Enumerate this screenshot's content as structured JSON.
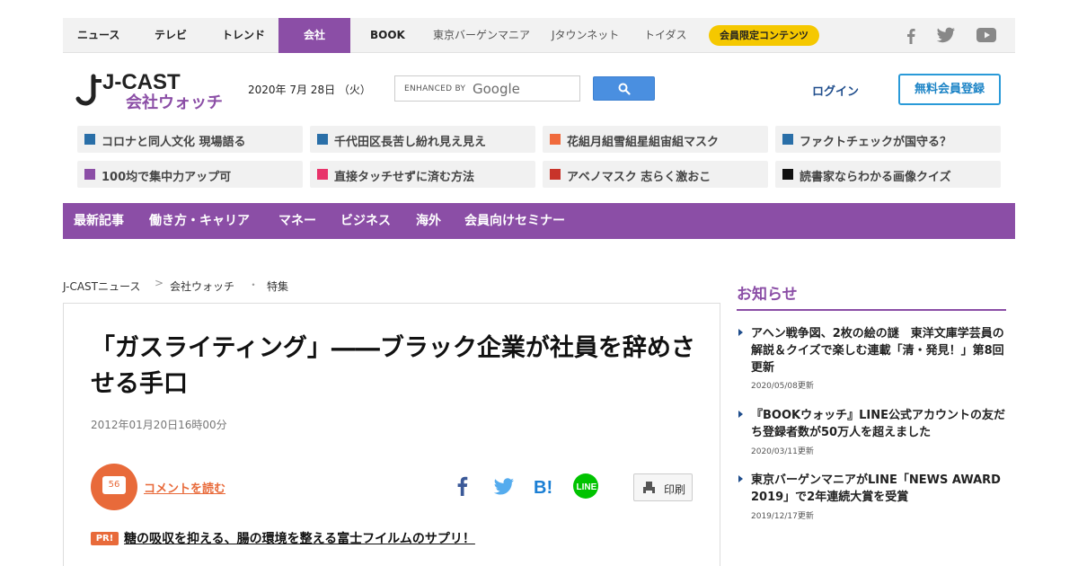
{
  "topnav": {
    "items": [
      "ニュース",
      "テレビ",
      "トレンド",
      "会社",
      "BOOK",
      "東京バーゲンマニア",
      "Jタウンネット",
      "トイダス"
    ],
    "member_label": "会員限定コンテンツ"
  },
  "header": {
    "logo_top": "J-CAST",
    "logo_bottom": "会社ウォッチ",
    "date": "2020年 7月 28日 （火）",
    "search_enhanced": "ENHANCED BY",
    "search_google": "Google",
    "login": "ログイン",
    "register": "無料会員登録"
  },
  "topics": [
    {
      "text": "コロナと同人文化 現場語る",
      "color": "#2a6fa8"
    },
    {
      "text": "千代田区長苦し紛れ見え見え",
      "color": "#2a6fa8"
    },
    {
      "text": "花組月組雪組星組宙組マスク",
      "color": "#f06a3c"
    },
    {
      "text": "ファクトチェックが国守る？",
      "color": "#2a6fa8"
    },
    {
      "text": "100均で集中力アップ可",
      "color": "#8b4ea6"
    },
    {
      "text": "直接タッチせずに済む方法",
      "color": "#e8336a"
    },
    {
      "text": "アベノマスク 志らく激おこ",
      "color": "#c8342a"
    },
    {
      "text": "読書家ならわかる画像クイズ",
      "color": "#111111"
    }
  ],
  "mainnav": [
    "最新記事",
    "働き方・キャリア",
    "マネー",
    "ビジネス",
    "海外",
    "会員向けセミナー"
  ],
  "breadcrumb": [
    "J-CASTニュース",
    "会社ウォッチ",
    "特集"
  ],
  "breadcrumb_separators": [
    ">",
    "・"
  ],
  "article": {
    "title": "「ガスライティング」――ブラック企業が社員を辞めさせる手口",
    "published": "2012年01月20日16時00分",
    "comment_count": "56",
    "comment_link": "コメントを読む",
    "print": "印刷",
    "pr_badge": "PR!",
    "pr_text": "糖の吸収を抑える、腸の環境を整える富士フイルムのサプリ！"
  },
  "sidebar": {
    "title": "お知らせ",
    "items": [
      {
        "text": "アヘン戦争図、2枚の絵の謎　東洋文庫学芸員の解説＆クイズで楽しむ連載「清・発見！」第8回更新",
        "date": "2020/05/08更新"
      },
      {
        "text": "『BOOKウォッチ』LINE公式アカウントの友だち登録者数が50万人を超えました",
        "date": "2020/03/11更新"
      },
      {
        "text": "東京バーゲンマニアがLINE「NEWS AWARD 2019」で2年連続大賞を受賞",
        "date": "2019/12/17更新"
      }
    ]
  },
  "colors": {
    "brand_purple": "#8b4ea6",
    "accent_orange": "#e86a3a",
    "member_yellow": "#f5c800",
    "link_blue": "#1f4d8c"
  },
  "icons": [
    "facebook-icon",
    "twitter-icon",
    "youtube-icon",
    "search-icon",
    "hatena-icon",
    "line-icon",
    "printer-icon",
    "comment-icon"
  ]
}
